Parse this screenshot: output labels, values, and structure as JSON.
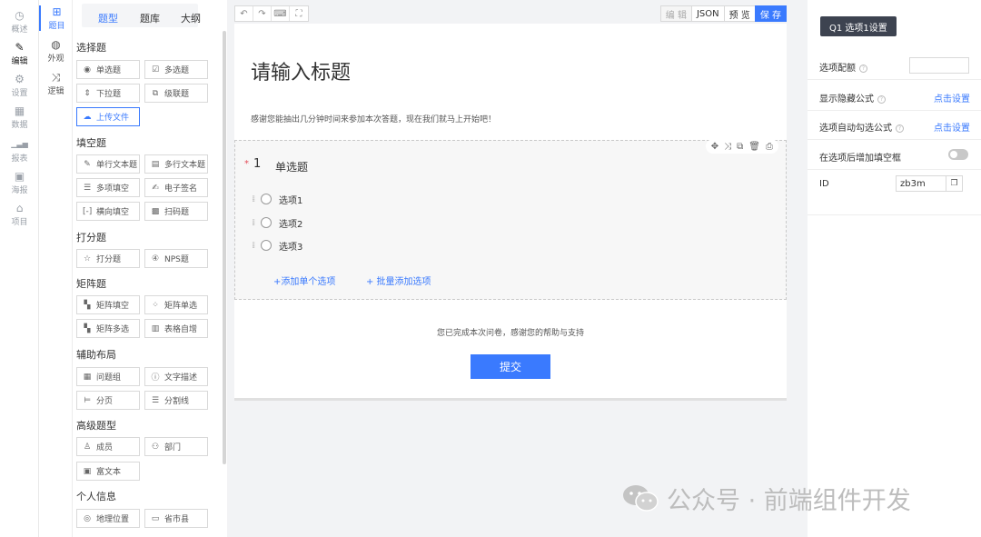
{
  "rail": {
    "items": [
      {
        "label": "概述",
        "icon": "dashboard-icon",
        "glyph": "◷"
      },
      {
        "label": "编辑",
        "icon": "pen-icon",
        "glyph": "✎"
      },
      {
        "label": "设置",
        "icon": "gear-icon",
        "glyph": "⚙"
      },
      {
        "label": "数据",
        "icon": "table-icon",
        "glyph": "▦"
      },
      {
        "label": "报表",
        "icon": "bar-chart-icon",
        "glyph": "▁▃▅"
      },
      {
        "label": "海报",
        "icon": "image-icon",
        "glyph": "▣"
      },
      {
        "label": "项目",
        "icon": "home-icon",
        "glyph": "⌂"
      }
    ]
  },
  "rail2": {
    "items": [
      {
        "label": "题目",
        "icon": "grid-icon",
        "glyph": "⊞"
      },
      {
        "label": "外观",
        "icon": "palette-icon",
        "glyph": "◍"
      },
      {
        "label": "逻辑",
        "icon": "shuffle-icon",
        "glyph": "⤨"
      }
    ]
  },
  "palette": {
    "tabs": [
      "题型",
      "题库",
      "大纲"
    ],
    "sections": {
      "choice": "选择题",
      "fill": "填空题",
      "score": "打分题",
      "matrix": "矩阵题",
      "layout": "辅助布局",
      "advanced": "高级题型",
      "personal": "个人信息"
    },
    "buttons": {
      "single": "单选题",
      "multi": "多选题",
      "dropdown": "下拉题",
      "cascade": "级联题",
      "upload": "上传文件",
      "single_text": "单行文本题",
      "multi_text": "多行文本题",
      "multi_fill": "多项填空",
      "signature": "电子签名",
      "horiz_fill": "横向填空",
      "scan": "扫码题",
      "rating": "打分题",
      "nps": "NPS题",
      "matrix_fill": "矩阵填空",
      "matrix_single": "矩阵单选",
      "matrix_multi": "矩阵多选",
      "table_auto": "表格自增",
      "group": "问题组",
      "text_desc": "文字描述",
      "paging": "分页",
      "divider": "分割线",
      "member": "成员",
      "dept": "部门",
      "richtext": "富文本",
      "location": "地理位置",
      "region": "省市县"
    }
  },
  "toolbar": {
    "edit": "编 辑",
    "json": "JSON",
    "preview": "预 览",
    "save": "保 存"
  },
  "survey": {
    "title": "请输入标题",
    "desc": "感谢您能抽出几分钟时间来参加本次答题，现在我们就马上开始吧！",
    "question": {
      "required": "*",
      "number": "1",
      "title": "单选题",
      "options": [
        "选项1",
        "选项2",
        "选项3"
      ],
      "add_single": "+添加单个选项",
      "add_batch": "+ 批量添加选项"
    },
    "thanks": "您已完成本次问卷，感谢您的帮助与支持",
    "submit": "提交"
  },
  "panel": {
    "tag": "Q1 选项1设置",
    "rows": {
      "score_label": "选项配额",
      "hide_formula": "显示隐藏公式",
      "hide_formula_link": "点击设置",
      "auto_check": "选项自动勾选公式",
      "auto_check_link": "点击设置",
      "add_fill": "在选项后增加填空框",
      "id_label": "ID",
      "id_value": "zb3m"
    }
  },
  "watermark": {
    "text": "公众号 · 前端组件开发"
  }
}
